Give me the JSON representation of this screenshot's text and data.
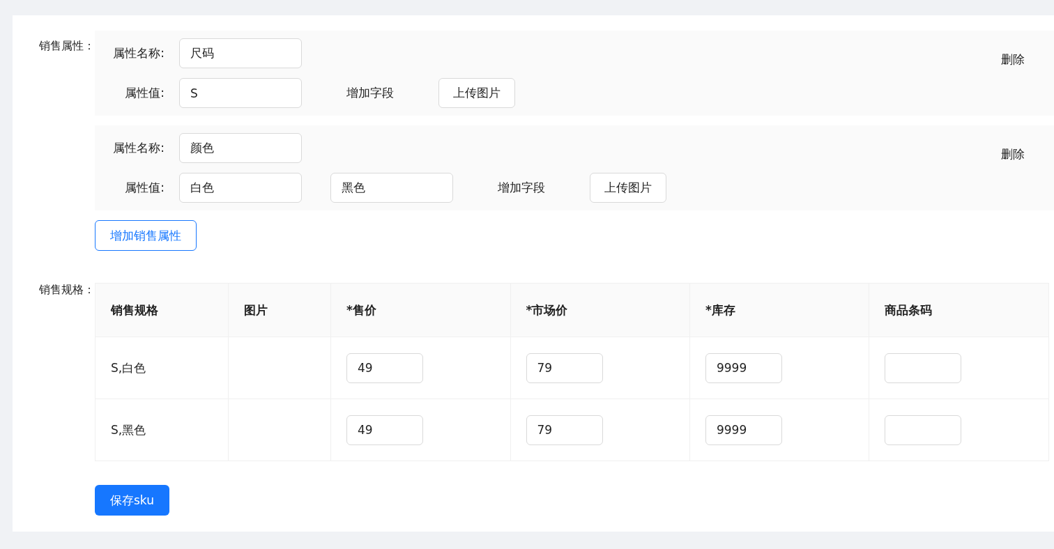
{
  "sales_attributes": {
    "label": "销售属性：",
    "groups": [
      {
        "name_label": "属性名称:",
        "name_value": "尺码",
        "values_label": "属性值:",
        "values": [
          "S"
        ],
        "add_field": "增加字段",
        "upload": "上传图片",
        "delete": "删除"
      },
      {
        "name_label": "属性名称:",
        "name_value": "颜色",
        "values_label": "属性值:",
        "values": [
          "白色",
          "黑色"
        ],
        "add_field": "增加字段",
        "upload": "上传图片",
        "delete": "删除"
      }
    ],
    "add_button": "增加销售属性"
  },
  "sales_specs": {
    "label": "销售规格：",
    "columns": [
      "销售规格",
      "图片",
      "*售价",
      "*市场价",
      "*库存",
      "商品条码"
    ],
    "rows": [
      {
        "spec": "S,白色",
        "price": "49",
        "market_price": "79",
        "stock": "9999"
      },
      {
        "spec": "S,黑色",
        "price": "49",
        "market_price": "79",
        "stock": "9999"
      }
    ]
  },
  "save_button": "保存sku"
}
